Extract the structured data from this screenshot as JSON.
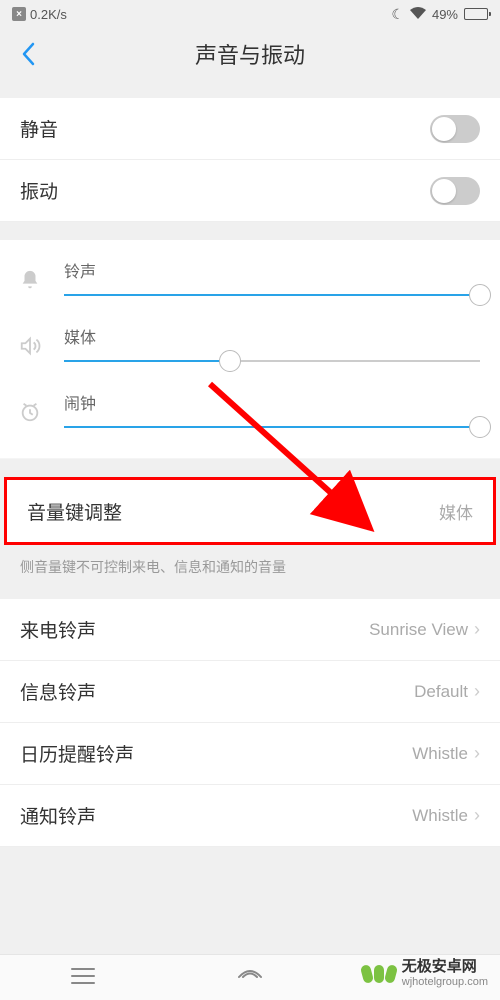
{
  "status": {
    "speed": "0.2K/s",
    "battery_pct": "49%"
  },
  "nav": {
    "title": "声音与振动"
  },
  "toggles": {
    "silent": {
      "label": "静音",
      "on": false
    },
    "vibrate": {
      "label": "振动",
      "on": false
    }
  },
  "sliders": {
    "ringtone": {
      "label": "铃声",
      "value": 100
    },
    "media": {
      "label": "媒体",
      "value": 40
    },
    "alarm": {
      "label": "闹钟",
      "value": 100
    }
  },
  "volume_key": {
    "label": "音量键调整",
    "value": "媒体"
  },
  "footnote": "侧音量键不可控制来电、信息和通知的音量",
  "ringtones": {
    "incoming": {
      "label": "来电铃声",
      "value": "Sunrise View"
    },
    "message": {
      "label": "信息铃声",
      "value": "Default"
    },
    "calendar": {
      "label": "日历提醒铃声",
      "value": "Whistle"
    },
    "notification": {
      "label": "通知铃声",
      "value": "Whistle"
    }
  },
  "watermark": {
    "title": "无极安卓网",
    "url": "wjhotelgroup.com"
  }
}
